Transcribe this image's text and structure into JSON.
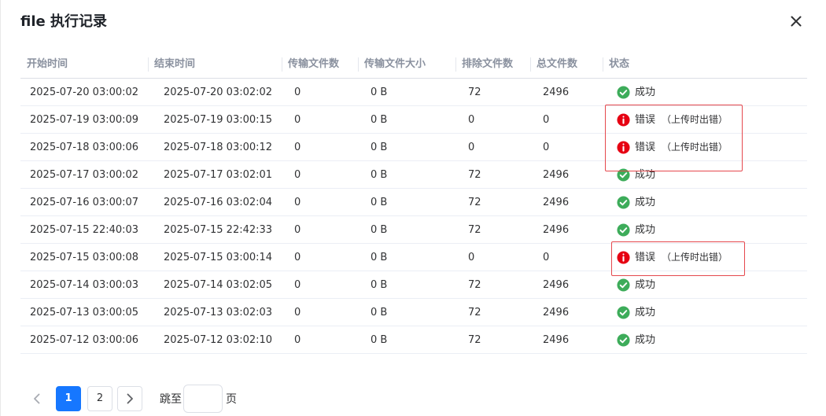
{
  "dialog": {
    "title": "file 执行记录"
  },
  "table": {
    "headers": [
      "开始时间",
      "结束时间",
      "传输文件数",
      "传输文件大小",
      "排除文件数",
      "总文件数",
      "状态"
    ],
    "rows": [
      {
        "start": "2025-07-20 03:00:02",
        "end": "2025-07-20 03:02:02",
        "files": "0",
        "size": "0 B",
        "excluded": "72",
        "total": "2496",
        "status": "success",
        "status_label": "成功",
        "detail": ""
      },
      {
        "start": "2025-07-19 03:00:09",
        "end": "2025-07-19 03:00:15",
        "files": "0",
        "size": "0 B",
        "excluded": "0",
        "total": "0",
        "status": "error",
        "status_label": "错误",
        "detail": "（上传时出错）"
      },
      {
        "start": "2025-07-18 03:00:06",
        "end": "2025-07-18 03:00:12",
        "files": "0",
        "size": "0 B",
        "excluded": "0",
        "total": "0",
        "status": "error",
        "status_label": "错误",
        "detail": "（上传时出错）"
      },
      {
        "start": "2025-07-17 03:00:02",
        "end": "2025-07-17 03:02:01",
        "files": "0",
        "size": "0 B",
        "excluded": "72",
        "total": "2496",
        "status": "success",
        "status_label": "成功",
        "detail": ""
      },
      {
        "start": "2025-07-16 03:00:07",
        "end": "2025-07-16 03:02:04",
        "files": "0",
        "size": "0 B",
        "excluded": "72",
        "total": "2496",
        "status": "success",
        "status_label": "成功",
        "detail": ""
      },
      {
        "start": "2025-07-15 22:40:03",
        "end": "2025-07-15 22:42:33",
        "files": "0",
        "size": "0 B",
        "excluded": "72",
        "total": "2496",
        "status": "success",
        "status_label": "成功",
        "detail": ""
      },
      {
        "start": "2025-07-15 03:00:08",
        "end": "2025-07-15 03:00:14",
        "files": "0",
        "size": "0 B",
        "excluded": "0",
        "total": "0",
        "status": "error",
        "status_label": "错误",
        "detail": "（上传时出错）"
      },
      {
        "start": "2025-07-14 03:00:03",
        "end": "2025-07-14 03:02:05",
        "files": "0",
        "size": "0 B",
        "excluded": "72",
        "total": "2496",
        "status": "success",
        "status_label": "成功",
        "detail": ""
      },
      {
        "start": "2025-07-13 03:00:05",
        "end": "2025-07-13 03:02:03",
        "files": "0",
        "size": "0 B",
        "excluded": "72",
        "total": "2496",
        "status": "success",
        "status_label": "成功",
        "detail": ""
      },
      {
        "start": "2025-07-12 03:00:06",
        "end": "2025-07-12 03:02:10",
        "files": "0",
        "size": "0 B",
        "excluded": "72",
        "total": "2496",
        "status": "success",
        "status_label": "成功",
        "detail": ""
      }
    ]
  },
  "pagination": {
    "pages": [
      "1",
      "2"
    ],
    "current": "1",
    "jump_label": "跳至",
    "jump_suffix": "页",
    "jump_value": ""
  },
  "icons": {
    "close": "close-icon",
    "success": "check-circle-icon",
    "error": "info-circle-icon",
    "prev": "chevron-left-icon",
    "next": "chevron-right-icon"
  },
  "colors": {
    "success": "#3dac5a",
    "error": "#e60012",
    "primary": "#1677ff",
    "highlight": "#e5484d"
  }
}
